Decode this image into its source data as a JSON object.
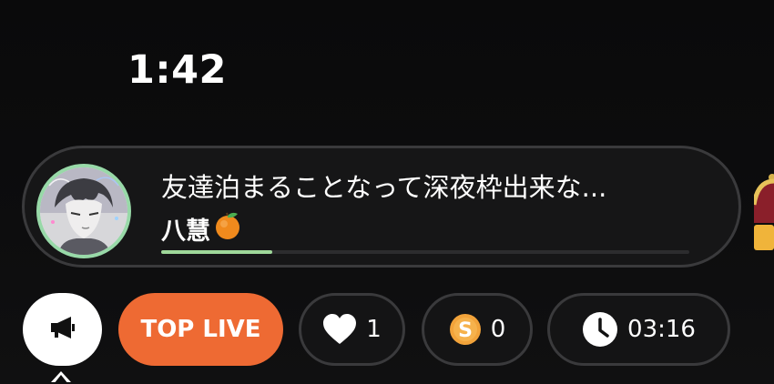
{
  "status_bar": {
    "time": "1:42"
  },
  "live_card": {
    "title": "友達泊まることなって深夜枠出来な...",
    "streamer_name": "八慧",
    "name_emoji": "orange-icon",
    "progress": 0.21,
    "avatar_ring_color": "#98d9a8",
    "progress_color": "#9fd89a"
  },
  "toolbar": {
    "megaphone_icon": "megaphone-icon",
    "top_live_label": "TOP LIVE",
    "top_live_color": "#ee6a33",
    "likes": {
      "icon": "heart-icon",
      "count": "1"
    },
    "coins": {
      "icon": "coin-s-icon",
      "letter": "S",
      "count": "0"
    },
    "timer": {
      "icon": "clock-icon",
      "value": "03:16"
    }
  }
}
